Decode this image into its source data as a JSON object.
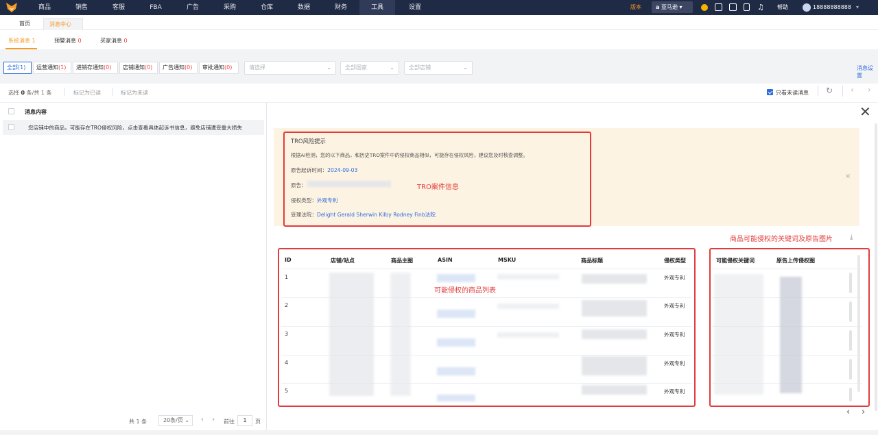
{
  "nav": {
    "items": [
      "商品",
      "销售",
      "客服",
      "FBA",
      "广告",
      "采购",
      "仓库",
      "数据",
      "财务",
      "工具",
      "设置"
    ],
    "active_index": 9,
    "version": "版本",
    "store": "亚马逊",
    "help": "帮助",
    "user": "18888888888"
  },
  "tabs": {
    "home": "首页",
    "current": "消息中心"
  },
  "subtabs": [
    {
      "label": "系统消息",
      "count": "1"
    },
    {
      "label": "预警消息",
      "count": "0"
    },
    {
      "label": "买家消息",
      "count": "0"
    }
  ],
  "filters": {
    "buttons": [
      {
        "label": "全部",
        "count": "(1)"
      },
      {
        "label": "运营通知",
        "count": "(1)"
      },
      {
        "label": "进销存通知",
        "count": "(0)"
      },
      {
        "label": "店铺通知",
        "count": "(0)"
      },
      {
        "label": "广告通知",
        "count": "(0)"
      },
      {
        "label": "审批通知",
        "count": "(0)"
      }
    ],
    "select1": "请选择",
    "select2": "全部国家",
    "select3": "全部店铺",
    "settings": "消息设置"
  },
  "toolbar": {
    "selected_prefix": "选择",
    "selected_count": "0",
    "selected_suffix": "条/共 1 条",
    "mark_read": "标记为已读",
    "mark_unread": "标记为未读",
    "only_unread": "只看未读消息"
  },
  "list": {
    "header": "消息内容",
    "items": [
      "您店铺中的商品，可能存在TRO侵权风险，点击查看具体起诉书信息，避免店铺遭受重大损失"
    ]
  },
  "pager": {
    "total": "共 1 条",
    "per_page": "20条/页",
    "goto": "前往",
    "page": "1",
    "page_unit": "页"
  },
  "notice": {
    "title": "TRO风险提示",
    "desc": "根据AI检测，您的以下商品，和历史TRO案件中的侵权商品相似，可能存在侵权风险，建议您及时核查调整。",
    "date_label": "原告起诉时间：",
    "date": "2024-09-03",
    "plaintiff_label": "原告：",
    "type_label": "侵权类型：",
    "type": "外观专利",
    "court_label": "受理法院：",
    "court": "Delight Gerald Sherwin Kilby Rodney Finb法院"
  },
  "annotations": {
    "case_info": "TRO案件信息",
    "keywords": "商品可能侵权的关键词及原告图片",
    "product_list": "可能侵权的商品列表"
  },
  "table": {
    "headers": [
      "ID",
      "店铺/站点",
      "商品主图",
      "ASIN",
      "MSKU",
      "商品标题",
      "侵权类型"
    ],
    "rows": [
      {
        "id": "1",
        "type": "外观专利"
      },
      {
        "id": "2",
        "type": "外观专利"
      },
      {
        "id": "3",
        "type": "外观专利"
      },
      {
        "id": "4",
        "type": "外观专利"
      },
      {
        "id": "5",
        "type": "外观专利"
      }
    ]
  },
  "table2": {
    "headers": [
      "可能侵权关键词",
      "原告上传侵权图"
    ]
  },
  "colors": {
    "accent": "#f59a23",
    "link": "#2d6cdf",
    "annotation": "#e23b3b",
    "nav_bg": "#1f2a44"
  }
}
